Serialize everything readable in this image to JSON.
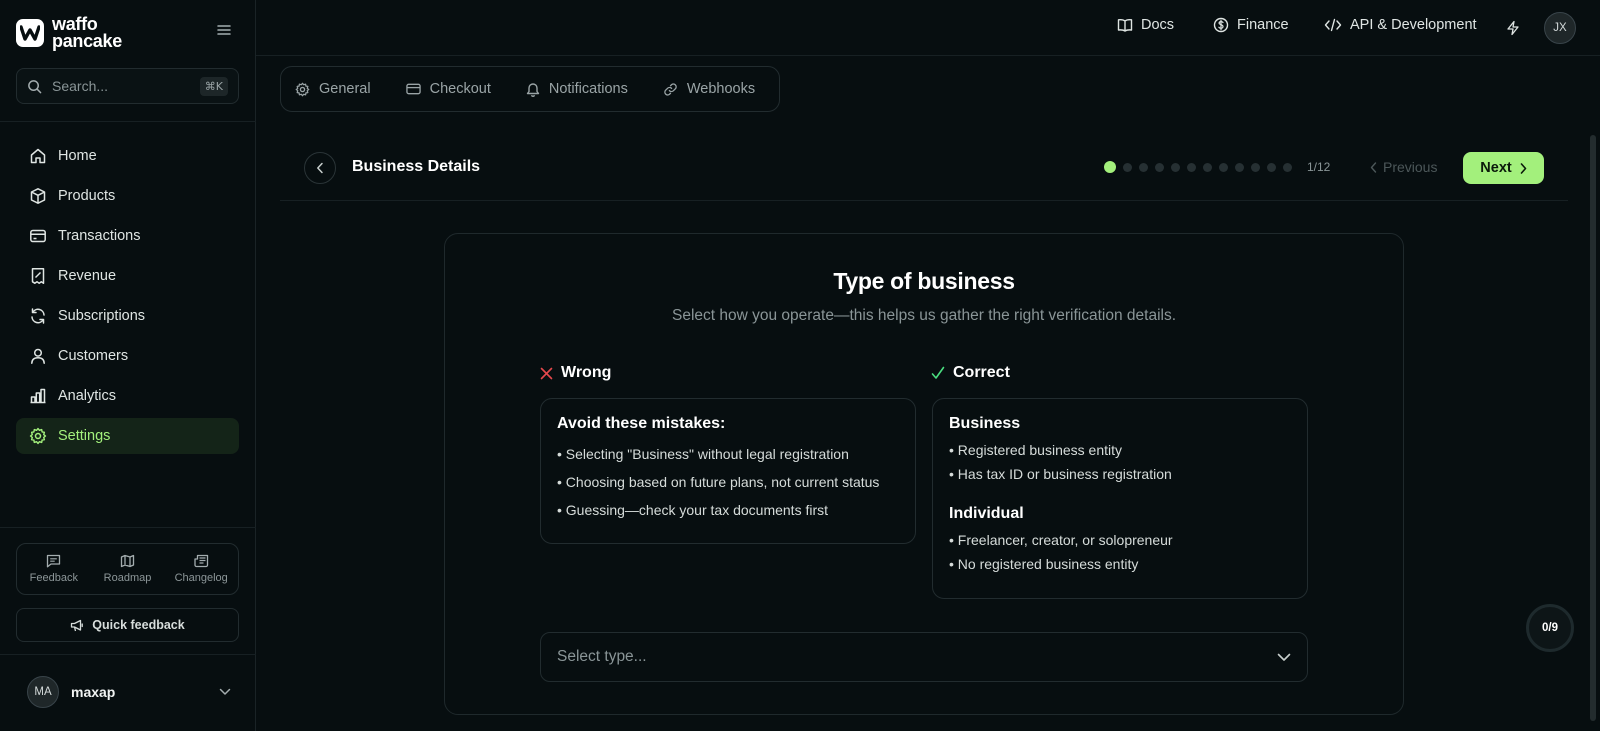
{
  "brand": {
    "line1": "waffo",
    "line2": "pancake"
  },
  "search": {
    "placeholder": "Search...",
    "shortcut": "⌘K"
  },
  "sidebar": {
    "items": [
      {
        "label": "Home",
        "icon": "home-icon"
      },
      {
        "label": "Products",
        "icon": "box-icon"
      },
      {
        "label": "Transactions",
        "icon": "credit-card-icon"
      },
      {
        "label": "Revenue",
        "icon": "receipt-icon"
      },
      {
        "label": "Subscriptions",
        "icon": "refresh-icon"
      },
      {
        "label": "Customers",
        "icon": "user-icon"
      },
      {
        "label": "Analytics",
        "icon": "bar-chart-icon"
      },
      {
        "label": "Settings",
        "icon": "gear-icon",
        "active": true
      }
    ],
    "tools": [
      {
        "label": "Feedback",
        "icon": "message-icon"
      },
      {
        "label": "Roadmap",
        "icon": "map-icon"
      },
      {
        "label": "Changelog",
        "icon": "newspaper-icon"
      }
    ],
    "quick_feedback": "Quick feedback",
    "user": {
      "initials": "MA",
      "name": "maxap"
    }
  },
  "topbar": {
    "links": [
      {
        "label": "Docs",
        "icon": "book-icon"
      },
      {
        "label": "Finance",
        "icon": "dollar-circle-icon"
      },
      {
        "label": "API & Development",
        "icon": "code-icon"
      }
    ],
    "avatar_initials": "JX"
  },
  "tabs": [
    {
      "label": "General",
      "icon": "gear-icon"
    },
    {
      "label": "Checkout",
      "icon": "card-icon"
    },
    {
      "label": "Notifications",
      "icon": "bell-icon"
    },
    {
      "label": "Webhooks",
      "icon": "link-icon"
    }
  ],
  "step": {
    "title": "Business Details",
    "current": 1,
    "total": 12,
    "counter": "1/12",
    "previous_label": "Previous",
    "next_label": "Next"
  },
  "card": {
    "title": "Type of business",
    "subtitle": "Select how you operate—this helps us gather the right verification details.",
    "wrong": {
      "label": "Wrong",
      "heading": "Avoid these mistakes:",
      "items": [
        "• Selecting \"Business\" without legal registration",
        "• Choosing based on future plans, not current status",
        "• Guessing—check your tax documents first"
      ]
    },
    "correct": {
      "label": "Correct",
      "business_heading": "Business",
      "business_items": [
        "• Registered business entity",
        "• Has tax ID or business registration"
      ],
      "individual_heading": "Individual",
      "individual_items": [
        "• Freelancer, creator, or solopreneur",
        "• No registered business entity"
      ]
    },
    "select_placeholder": "Select type..."
  },
  "progress_badge": "0/9",
  "colors": {
    "accent": "#a3f07c",
    "wrong": "#e5484d",
    "correct": "#4ade80",
    "background": "#070e10"
  }
}
